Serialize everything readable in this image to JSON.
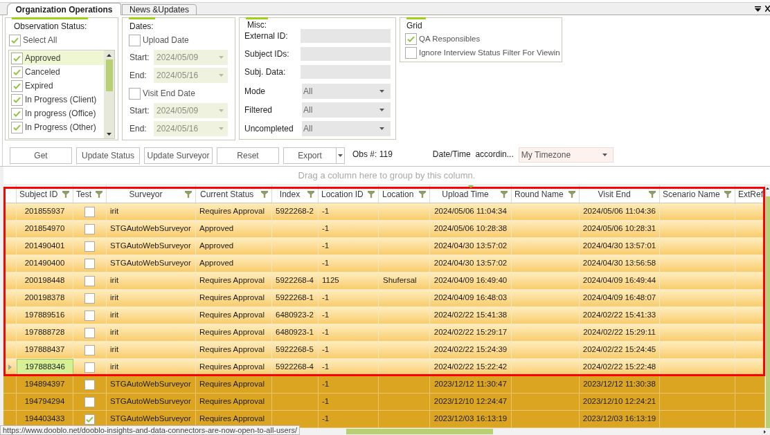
{
  "tabs": [
    {
      "label": "Organization Operations",
      "selected": true
    },
    {
      "label": "News &Updates",
      "selected": false
    }
  ],
  "observation_status": {
    "title": "Observation Status:",
    "select_all": {
      "label": "Select All",
      "checked": true
    },
    "items": [
      {
        "label": "Approved",
        "checked": true,
        "selected": true
      },
      {
        "label": "Canceled",
        "checked": true,
        "selected": false
      },
      {
        "label": "Expired",
        "checked": true,
        "selected": false
      },
      {
        "label": "In Progress (Client)",
        "checked": true,
        "selected": false
      },
      {
        "label": "In progress (Office)",
        "checked": true,
        "selected": false
      },
      {
        "label": "In Progress (Other)",
        "checked": true,
        "selected": false
      }
    ]
  },
  "dates": {
    "title": "Dates:",
    "filters": [
      {
        "label": "Upload Date",
        "checked": false,
        "range": [
          {
            "label": "Start:",
            "value": "2024/05/09"
          },
          {
            "label": "End:",
            "value": "2024/05/16"
          }
        ]
      },
      {
        "label": "Visit End Date",
        "checked": false,
        "range": [
          {
            "label": "Start:",
            "value": "2024/05/09"
          },
          {
            "label": "End:",
            "value": "2024/05/16"
          }
        ]
      }
    ]
  },
  "misc": {
    "title": "Misc:",
    "fields": [
      {
        "kind": "text",
        "label": "External ID:"
      },
      {
        "kind": "text",
        "label": "Subject IDs:"
      },
      {
        "kind": "text",
        "label": "Subj. Data:"
      },
      {
        "kind": "select",
        "label": "Mode",
        "value": "All"
      },
      {
        "kind": "select",
        "label": "Filtered",
        "value": "All"
      },
      {
        "kind": "select",
        "label": "Uncompleted",
        "value": "All"
      }
    ]
  },
  "grid_options": {
    "title": "Grid",
    "options": [
      {
        "label": "QA Responsibles",
        "checked": true
      },
      {
        "label": "Ignore Interview Status Filter For Viewin",
        "checked": false
      }
    ]
  },
  "toolbar": {
    "buttons": [
      {
        "kind": "button",
        "label": "Get"
      },
      {
        "kind": "button",
        "label": "Update Status"
      },
      {
        "kind": "button",
        "label": "Update Surveyor"
      },
      {
        "kind": "button",
        "label": "Reset"
      },
      {
        "kind": "split",
        "label": "Export"
      }
    ],
    "obs_count": "Obs #: 119",
    "datetime_label": "Date/Time  accordin...",
    "timezone": "My Timezone"
  },
  "table": {
    "group_hint": "Drag a column here to group by this column.",
    "columns": [
      {
        "kind": "text",
        "label": "Subject ID",
        "sorted": false
      },
      {
        "kind": "checkbox",
        "label": "Test",
        "sorted": false
      },
      {
        "kind": "text",
        "label": "Surveyor",
        "sorted": false
      },
      {
        "kind": "text",
        "label": "Current Status",
        "sorted": false
      },
      {
        "kind": "text",
        "label": "Index",
        "sorted": false
      },
      {
        "kind": "text",
        "label": "Location ID",
        "sorted": false
      },
      {
        "kind": "text",
        "label": "Location",
        "sorted": false
      },
      {
        "kind": "text",
        "label": "Upload Time",
        "sorted": true
      },
      {
        "kind": "text",
        "label": "Round Name",
        "sorted": false
      },
      {
        "kind": "text",
        "label": "Visit End",
        "sorted": false
      },
      {
        "kind": "text",
        "label": "Scenario Name",
        "sorted": false
      },
      {
        "kind": "text",
        "label": "ExtRef",
        "sorted": false
      }
    ],
    "rows": [
      {
        "selected": true,
        "focused": false,
        "cells": [
          "201855937",
          {
            "checked": false
          },
          "irit",
          "Requires Approval",
          "5922268-2",
          "-1",
          "",
          "2024/05/06 11:04:34",
          "",
          "2024/05/06 11:04:36",
          "",
          ""
        ]
      },
      {
        "selected": true,
        "focused": false,
        "cells": [
          "201854970",
          {
            "checked": false
          },
          "STGAutoWebSurveyor",
          "Approved",
          "",
          "-1",
          "",
          "2024/05/06 10:28:38",
          "",
          "2024/05/06 10:28:31",
          "",
          ""
        ]
      },
      {
        "selected": true,
        "focused": false,
        "cells": [
          "201490401",
          {
            "checked": false
          },
          "STGAutoWebSurveyor",
          "Approved",
          "",
          "-1",
          "",
          "2024/04/30 13:57:02",
          "",
          "2024/04/30 13:57:01",
          "",
          ""
        ]
      },
      {
        "selected": true,
        "focused": false,
        "cells": [
          "201490400",
          {
            "checked": false
          },
          "STGAutoWebSurveyor",
          "Approved",
          "",
          "-1",
          "",
          "2024/04/30 13:57:02",
          "",
          "2024/04/30 13:56:58",
          "",
          ""
        ]
      },
      {
        "selected": true,
        "focused": false,
        "cells": [
          "200198448",
          {
            "checked": false
          },
          "irit",
          "Requires Approval",
          "5922268-4",
          "1125",
          "Shufersal",
          "2024/04/09 16:49:40",
          "",
          "2024/04/09 16:49:44",
          "",
          ""
        ]
      },
      {
        "selected": true,
        "focused": false,
        "cells": [
          "200198378",
          {
            "checked": false
          },
          "irit",
          "Requires Approval",
          "5922268-1",
          "-1",
          "",
          "2024/04/09 16:48:03",
          "",
          "2024/04/09 16:48:07",
          "",
          ""
        ]
      },
      {
        "selected": true,
        "focused": false,
        "cells": [
          "197889516",
          {
            "checked": false
          },
          "irit",
          "Requires Approval",
          "6480923-2",
          "-1",
          "",
          "2024/02/22 15:41:38",
          "",
          "2024/02/22 15:41:33",
          "",
          ""
        ]
      },
      {
        "selected": true,
        "focused": false,
        "cells": [
          "197888728",
          {
            "checked": false
          },
          "irit",
          "Requires Approval",
          "6480923-1",
          "-1",
          "",
          "2024/02/22 15:29:17",
          "",
          "2024/02/22 15:29:11",
          "",
          ""
        ]
      },
      {
        "selected": true,
        "focused": false,
        "cells": [
          "197888437",
          {
            "checked": false
          },
          "irit",
          "Requires Approval",
          "5922268-5",
          "-1",
          "",
          "2024/02/22 15:24:39",
          "",
          "2024/02/22 15:24:45",
          "",
          ""
        ]
      },
      {
        "selected": true,
        "focused": true,
        "cells": [
          "197888346",
          {
            "checked": false
          },
          "irit",
          "Requires Approval",
          "5922268-4",
          "-1",
          "",
          "2024/02/22 15:22:42",
          "",
          "2024/02/22 15:22:48",
          "",
          ""
        ]
      },
      {
        "selected": false,
        "focused": false,
        "cells": [
          "194894397",
          {
            "checked": false
          },
          "STGAutoWebSurveyor",
          "Requires Approval",
          "",
          "-1",
          "",
          "2023/12/12 11:30:47",
          "",
          "2023/12/12 11:30:38",
          "",
          ""
        ]
      },
      {
        "selected": false,
        "focused": false,
        "cells": [
          "194794294",
          {
            "checked": false
          },
          "STGAutoWebSurveyor",
          "Requires Approval",
          "",
          "-1",
          "",
          "2023/12/10 12:24:47",
          "",
          "2023/12/10 12:24:21",
          "",
          ""
        ]
      },
      {
        "selected": false,
        "focused": false,
        "cells": [
          "194403433",
          {
            "checked": true
          },
          "STGAutoWebSurveyor",
          "Requires Approval",
          "",
          "-1",
          "",
          "2023/12/03 16:13:19",
          "",
          "2023/12/03 16:13:19",
          "",
          ""
        ]
      }
    ]
  },
  "status_tooltip": "https://www.dooblo.net/dooblo-insights-and-data-connectors-are-now-open-to-all-users/"
}
